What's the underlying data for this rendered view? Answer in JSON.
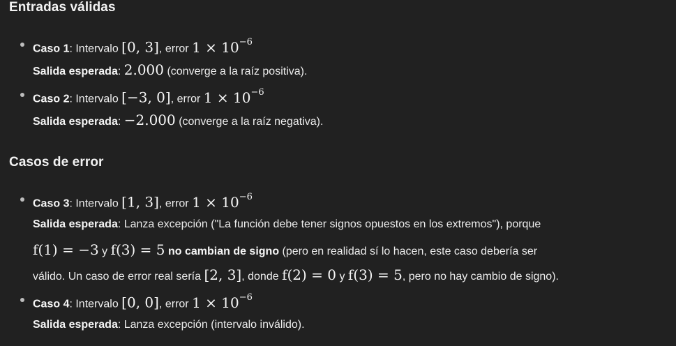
{
  "sections": [
    {
      "heading": "Entradas válidas",
      "items": [
        {
          "case_label": "Caso 1",
          "interval_text": ": Intervalo ",
          "interval": "[0, 3]",
          "error_text": ", error ",
          "error_mantissa": "1 × 10",
          "error_exp": "−6",
          "output_label": "Salida esperada",
          "output_sep": ": ",
          "output_value": "2.000",
          "output_note": " (converge a la raíz positiva)."
        },
        {
          "case_label": "Caso 2",
          "interval_text": ": Intervalo ",
          "interval": "[−3, 0]",
          "error_text": ", error ",
          "error_mantissa": "1 × 10",
          "error_exp": "−6",
          "output_label": "Salida esperada",
          "output_sep": ": ",
          "output_value": "−2.000",
          "output_note": " (converge a la raíz negativa)."
        }
      ]
    },
    {
      "heading": "Casos de error",
      "items": [
        {
          "case_label": "Caso 3",
          "interval_text": ": Intervalo ",
          "interval": "[1, 3]",
          "error_text": ", error ",
          "error_mantissa": "1 × 10",
          "error_exp": "−6",
          "output_label": "Salida esperada",
          "output_sep": ": ",
          "output_text": "Lanza excepción (\"La función debe tener signos opuestos en los extremos\"), porque",
          "line2_f1": "f(1) = −3",
          "line2_y": " y ",
          "line2_f3": "f(3) = 5",
          "line2_bold": " no cambian de signo",
          "line2_rest": " (pero en realidad sí lo hacen, este caso debería ser",
          "line3_a": "válido. Un caso de error real sería ",
          "line3_interval": "[2, 3]",
          "line3_b": ", donde ",
          "line3_f2": "f(2) = 0",
          "line3_y": " y ",
          "line3_f3": "f(3) = 5",
          "line3_c": ", pero no hay cambio de signo)."
        },
        {
          "case_label": "Caso 4",
          "interval_text": ": Intervalo ",
          "interval": "[0, 0]",
          "error_text": ", error ",
          "error_mantissa": "1 × 10",
          "error_exp": "−6",
          "output_label": "Salida esperada",
          "output_sep": ": ",
          "output_text": "Lanza excepción (intervalo inválido)."
        }
      ]
    }
  ]
}
